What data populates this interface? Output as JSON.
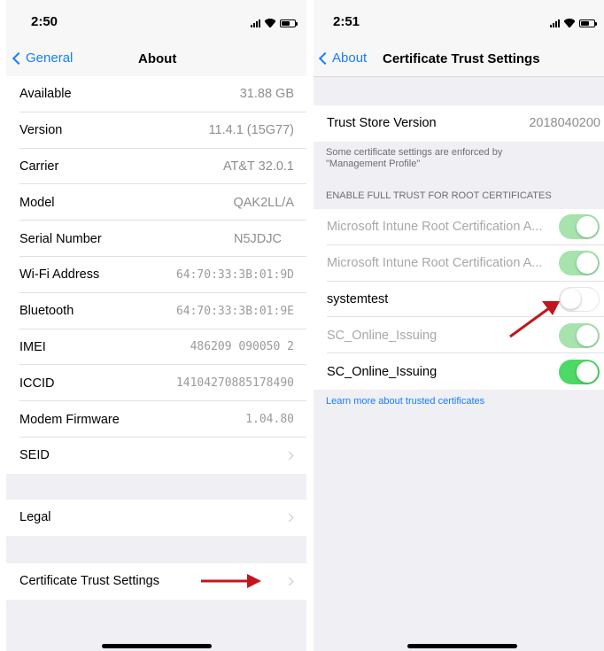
{
  "left": {
    "time": "2:50",
    "back_label": "General",
    "title": "About",
    "rows": [
      {
        "label": "Available",
        "value": "31.88 GB"
      },
      {
        "label": "Version",
        "value": "11.4.1 (15G77)"
      },
      {
        "label": "Carrier",
        "value": "AT&T 32.0.1"
      },
      {
        "label": "Model",
        "value": "QAK2LL/A"
      },
      {
        "label": "Serial Number",
        "value": "N5JDJC"
      },
      {
        "label": "Wi-Fi Address",
        "value": "64:70:33:3B:01:9D"
      },
      {
        "label": "Bluetooth",
        "value": "64:70:33:3B:01:9E"
      },
      {
        "label": "IMEI",
        "value": "486209 090050 2"
      },
      {
        "label": "ICCID",
        "value": "14104270885178490"
      },
      {
        "label": "Modem Firmware",
        "value": "1.04.80"
      },
      {
        "label": "SEID",
        "value": ""
      }
    ],
    "legal_label": "Legal",
    "cert_label": "Certificate Trust Settings"
  },
  "right": {
    "time": "2:51",
    "back_label": "About",
    "title": "Certificate Trust Settings",
    "trust_store_label": "Trust Store Version",
    "trust_store_value": "2018040200",
    "note_line1": "Some certificate settings are enforced by",
    "note_line2": "\"Management Profile\"",
    "section_header": "ENABLE FULL TRUST FOR ROOT CERTIFICATES",
    "certs": [
      {
        "label": "Microsoft Intune Root Certification A...",
        "enabled": true,
        "dimmed": true
      },
      {
        "label": "Microsoft Intune Root Certification A...",
        "enabled": true,
        "dimmed": true
      },
      {
        "label": "systemtest",
        "enabled": false,
        "dimmed": false
      },
      {
        "label": "SC_Online_Issuing",
        "enabled": true,
        "dimmed": true
      },
      {
        "label": "SC_Online_Issuing",
        "enabled": true,
        "dimmed": false
      }
    ],
    "learn_more": "Learn more about trusted certificates"
  },
  "colors": {
    "accent": "#157efb",
    "toggle_on": "#4cd964",
    "arrow": "#c0171d",
    "background": "#efeff4"
  }
}
